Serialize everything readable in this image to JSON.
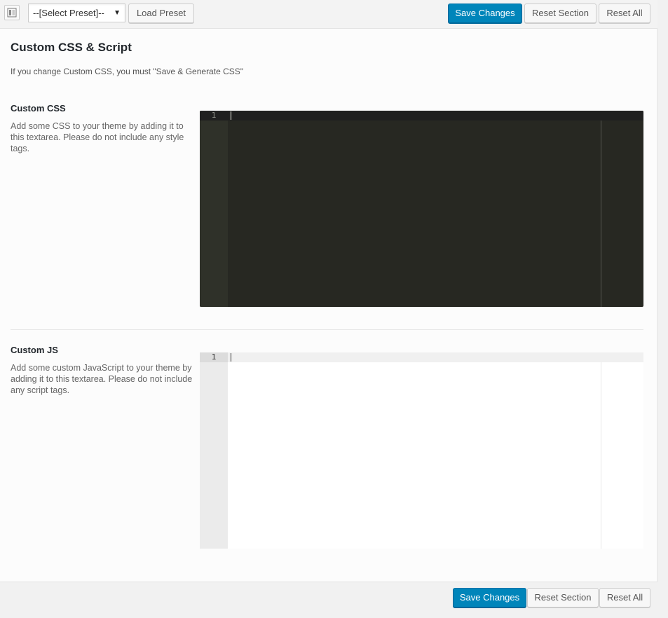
{
  "toolbar": {
    "preset_select": "--[Select Preset]--",
    "load_preset": "Load Preset",
    "save_changes": "Save Changes",
    "reset_section": "Reset Section",
    "reset_all": "Reset All"
  },
  "section": {
    "title": "Custom CSS & Script",
    "description": "If you change Custom CSS, you must \"Save & Generate CSS\""
  },
  "fields": {
    "css": {
      "title": "Custom CSS",
      "description": "Add some CSS to your theme by adding it to this textarea. Please do not include any style tags.",
      "line_number": "1"
    },
    "js": {
      "title": "Custom JS",
      "description": "Add some custom JavaScript to your theme by adding it to this textarea. Please do not include any script tags.",
      "line_number": "1"
    }
  },
  "footer": {
    "save_changes": "Save Changes",
    "reset_section": "Reset Section",
    "reset_all": "Reset All"
  },
  "colors": {
    "primary_button": "#0085ba",
    "dark_editor_bg": "#272822",
    "light_editor_bg": "#ffffff"
  },
  "icons": {
    "toggle": "panel-layout-icon",
    "dropdown": "caret-down-icon"
  }
}
